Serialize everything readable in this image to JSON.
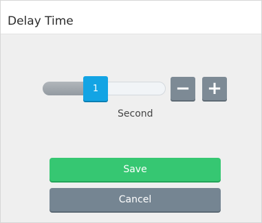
{
  "dialog": {
    "title": "Delay Time"
  },
  "slider": {
    "value": "1",
    "fill_fraction": 0.43
  },
  "stepper": {
    "minus_label": "−",
    "plus_label": "+"
  },
  "unit_label": "Second",
  "actions": {
    "save_label": "Save",
    "cancel_label": "Cancel"
  },
  "colors": {
    "accent": "#13a4e4",
    "save": "#36c772",
    "cancel": "#758592",
    "stepper": "#7d8a95"
  }
}
